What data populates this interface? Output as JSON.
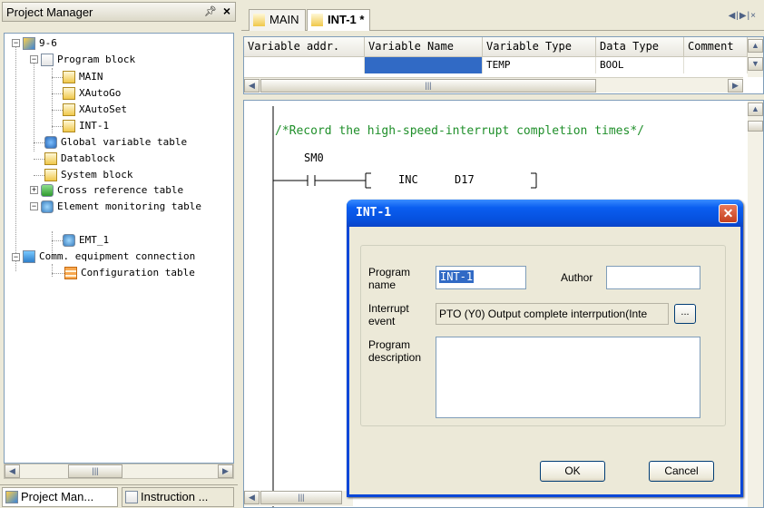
{
  "project_manager": {
    "title": "Project Manager",
    "pin_icon": "pin-icon",
    "close_glyph": "×",
    "tree": {
      "root": "9-6",
      "program_block": "Program block",
      "programs": [
        "MAIN",
        "XAutoGo",
        "XAutoSet",
        "INT-1"
      ],
      "global_variable_table": "Global variable table",
      "datablock": "Datablock",
      "system_block": "System block",
      "cross_reference_table": "Cross reference table",
      "element_monitoring_table": "Element monitoring table",
      "emt": "EMT_1",
      "comm_equipment": "Comm. equipment connection",
      "configuration_table": "Configuration table"
    },
    "bottom_tabs": [
      "Project Man...",
      "Instruction ..."
    ]
  },
  "editor": {
    "tabs": [
      "MAIN",
      "INT-1 *"
    ],
    "tab_nav": "◀|▶|×",
    "var_table": {
      "headers": [
        "Variable addr.",
        "Variable Name",
        "Variable Type",
        "Data Type",
        "Comment"
      ],
      "row": [
        "",
        "",
        "TEMP",
        "BOOL",
        ""
      ]
    },
    "ladder": {
      "comment": "/*Record the high-speed-interrupt completion times*/",
      "contact": "SM0",
      "instruction": "INC",
      "operand": "D17"
    }
  },
  "dialog": {
    "title": "INT-1",
    "close_glyph": "✕",
    "program_name_label": "Program name",
    "program_name_value": "INT-1",
    "author_label": "Author",
    "author_value": "",
    "interrupt_event_label": "Interrupt event",
    "interrupt_event_value": "PTO (Y0) Output complete interrpution(Inte",
    "browse_label": "...",
    "program_description_label": "Program description",
    "program_description_value": "",
    "ok_label": "OK",
    "cancel_label": "Cancel"
  }
}
